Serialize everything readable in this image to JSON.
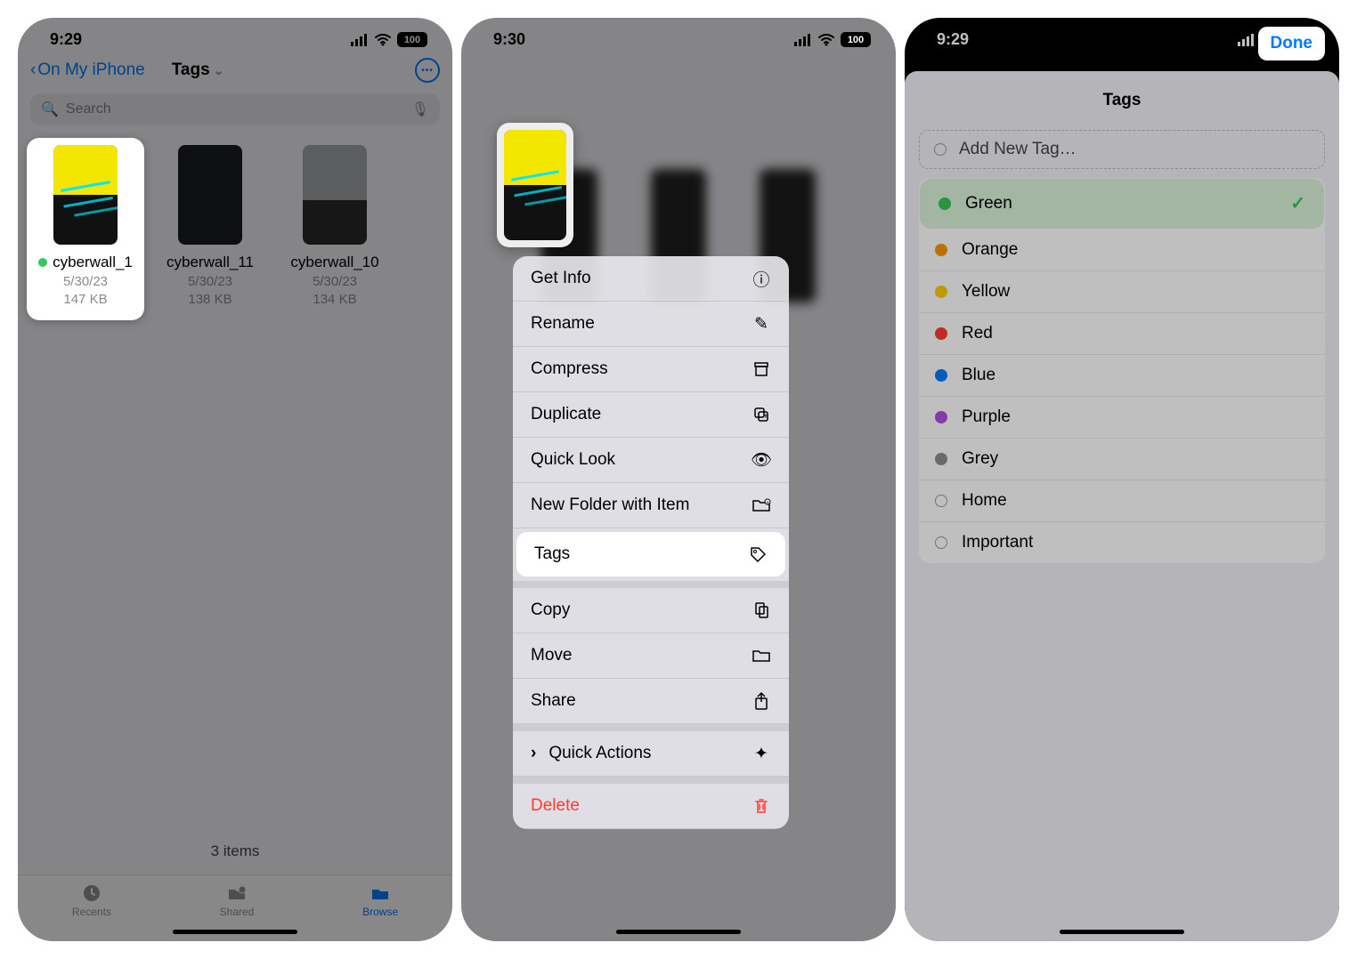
{
  "status": {
    "time1": "9:29",
    "time2": "9:30",
    "time3": "9:29",
    "battery": "100"
  },
  "screen1": {
    "back_label": "On My iPhone",
    "title": "Tags",
    "search_placeholder": "Search",
    "files": [
      {
        "name": "cyberwall_1",
        "date": "5/30/23",
        "size": "147 KB",
        "tagged": true
      },
      {
        "name": "cyberwall_11",
        "date": "5/30/23",
        "size": "138 KB",
        "tagged": false
      },
      {
        "name": "cyberwall_10",
        "date": "5/30/23",
        "size": "134 KB",
        "tagged": false
      }
    ],
    "count": "3 items",
    "tabs": {
      "recents": "Recents",
      "shared": "Shared",
      "browse": "Browse"
    }
  },
  "screen2": {
    "menu": {
      "get_info": "Get Info",
      "rename": "Rename",
      "compress": "Compress",
      "duplicate": "Duplicate",
      "quick_look": "Quick Look",
      "new_folder": "New Folder with Item",
      "tags": "Tags",
      "copy": "Copy",
      "move": "Move",
      "share": "Share",
      "quick_actions": "Quick Actions",
      "delete": "Delete"
    }
  },
  "screen3": {
    "title": "Tags",
    "done": "Done",
    "add_new": "Add New Tag…",
    "tags": [
      {
        "label": "Green",
        "color": "#34c759",
        "selected": true
      },
      {
        "label": "Orange",
        "color": "#ff9500"
      },
      {
        "label": "Yellow",
        "color": "#ffcc00"
      },
      {
        "label": "Red",
        "color": "#ff3b30"
      },
      {
        "label": "Blue",
        "color": "#007aff"
      },
      {
        "label": "Purple",
        "color": "#af52de"
      },
      {
        "label": "Grey",
        "color": "#8e8e93"
      },
      {
        "label": "Home",
        "color": null
      },
      {
        "label": "Important",
        "color": null
      }
    ]
  }
}
